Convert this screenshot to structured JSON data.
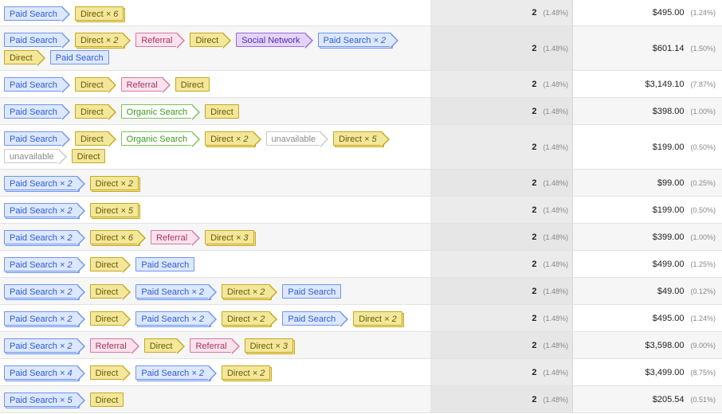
{
  "colors": {
    "paid_search": "#6f96ec",
    "direct": "#c6a81c",
    "referral": "#d67aa0",
    "social_network": "#9c6ad7",
    "organic_search": "#7cc25a",
    "unavailable": "#c9c9c9"
  },
  "rows": [
    {
      "h": 33,
      "path": [
        {
          "t": "paid",
          "label": "Paid Search",
          "mult": ""
        },
        {
          "t": "direct",
          "label": "Direct",
          "mult": "× 6"
        }
      ],
      "conversions": "2",
      "conv_pct": "(1.48%)",
      "value": "$495.00",
      "value_pct": "(1.24%)"
    },
    {
      "h": 56,
      "path": [
        {
          "t": "paid",
          "label": "Paid Search",
          "mult": ""
        },
        {
          "t": "direct",
          "label": "Direct",
          "mult": "× 2"
        },
        {
          "t": "ref",
          "label": "Referral",
          "mult": ""
        },
        {
          "t": "direct",
          "label": "Direct",
          "mult": ""
        },
        {
          "t": "social",
          "label": "Social Network",
          "mult": ""
        },
        {
          "t": "paid",
          "label": "Paid Search",
          "mult": "× 2"
        },
        {
          "t": "direct",
          "label": "Direct",
          "mult": ""
        },
        {
          "t": "paid",
          "label": "Paid Search",
          "mult": ""
        }
      ],
      "conversions": "2",
      "conv_pct": "(1.48%)",
      "value": "$601.14",
      "value_pct": "(1.50%)"
    },
    {
      "h": 34,
      "path": [
        {
          "t": "paid",
          "label": "Paid Search",
          "mult": ""
        },
        {
          "t": "direct",
          "label": "Direct",
          "mult": ""
        },
        {
          "t": "ref",
          "label": "Referral",
          "mult": ""
        },
        {
          "t": "direct",
          "label": "Direct",
          "mult": ""
        }
      ],
      "conversions": "2",
      "conv_pct": "(1.48%)",
      "value": "$3,149.10",
      "value_pct": "(7.87%)"
    },
    {
      "h": 34,
      "path": [
        {
          "t": "paid",
          "label": "Paid Search",
          "mult": ""
        },
        {
          "t": "direct",
          "label": "Direct",
          "mult": ""
        },
        {
          "t": "organic",
          "label": "Organic Search",
          "mult": ""
        },
        {
          "t": "direct",
          "label": "Direct",
          "mult": ""
        }
      ],
      "conversions": "2",
      "conv_pct": "(1.48%)",
      "value": "$398.00",
      "value_pct": "(1.00%)"
    },
    {
      "h": 56,
      "path": [
        {
          "t": "paid",
          "label": "Paid Search",
          "mult": ""
        },
        {
          "t": "direct",
          "label": "Direct",
          "mult": ""
        },
        {
          "t": "organic",
          "label": "Organic Search",
          "mult": ""
        },
        {
          "t": "direct",
          "label": "Direct",
          "mult": "× 2"
        },
        {
          "t": "unav",
          "label": "unavailable",
          "mult": ""
        },
        {
          "t": "direct",
          "label": "Direct",
          "mult": "× 5"
        },
        {
          "t": "unav",
          "label": "unavailable",
          "mult": ""
        },
        {
          "t": "direct",
          "label": "Direct",
          "mult": ""
        }
      ],
      "conversions": "2",
      "conv_pct": "(1.48%)",
      "value": "$199.00",
      "value_pct": "(0.50%)"
    },
    {
      "h": 34,
      "path": [
        {
          "t": "paid",
          "label": "Paid Search",
          "mult": "× 2"
        },
        {
          "t": "direct",
          "label": "Direct",
          "mult": "× 2"
        }
      ],
      "conversions": "2",
      "conv_pct": "(1.48%)",
      "value": "$99.00",
      "value_pct": "(0.25%)"
    },
    {
      "h": 34,
      "path": [
        {
          "t": "paid",
          "label": "Paid Search",
          "mult": "× 2"
        },
        {
          "t": "direct",
          "label": "Direct",
          "mult": "× 5"
        }
      ],
      "conversions": "2",
      "conv_pct": "(1.48%)",
      "value": "$199.00",
      "value_pct": "(0.50%)"
    },
    {
      "h": 34,
      "path": [
        {
          "t": "paid",
          "label": "Paid Search",
          "mult": "× 2"
        },
        {
          "t": "direct",
          "label": "Direct",
          "mult": "× 6"
        },
        {
          "t": "ref",
          "label": "Referral",
          "mult": ""
        },
        {
          "t": "direct",
          "label": "Direct",
          "mult": "× 3"
        }
      ],
      "conversions": "2",
      "conv_pct": "(1.48%)",
      "value": "$399.00",
      "value_pct": "(1.00%)"
    },
    {
      "h": 34,
      "path": [
        {
          "t": "paid",
          "label": "Paid Search",
          "mult": "× 2"
        },
        {
          "t": "direct",
          "label": "Direct",
          "mult": ""
        },
        {
          "t": "paid",
          "label": "Paid Search",
          "mult": ""
        }
      ],
      "conversions": "2",
      "conv_pct": "(1.48%)",
      "value": "$499.00",
      "value_pct": "(1.25%)"
    },
    {
      "h": 34,
      "path": [
        {
          "t": "paid",
          "label": "Paid Search",
          "mult": "× 2"
        },
        {
          "t": "direct",
          "label": "Direct",
          "mult": ""
        },
        {
          "t": "paid",
          "label": "Paid Search",
          "mult": "× 2"
        },
        {
          "t": "direct",
          "label": "Direct",
          "mult": "× 2"
        },
        {
          "t": "paid",
          "label": "Paid Search",
          "mult": ""
        }
      ],
      "conversions": "2",
      "conv_pct": "(1.48%)",
      "value": "$49.00",
      "value_pct": "(0.12%)"
    },
    {
      "h": 34,
      "path": [
        {
          "t": "paid",
          "label": "Paid Search",
          "mult": "× 2"
        },
        {
          "t": "direct",
          "label": "Direct",
          "mult": ""
        },
        {
          "t": "paid",
          "label": "Paid Search",
          "mult": "× 2"
        },
        {
          "t": "direct",
          "label": "Direct",
          "mult": "× 2"
        },
        {
          "t": "paid",
          "label": "Paid Search",
          "mult": ""
        },
        {
          "t": "direct",
          "label": "Direct",
          "mult": "× 2"
        }
      ],
      "conversions": "2",
      "conv_pct": "(1.48%)",
      "value": "$495.00",
      "value_pct": "(1.24%)"
    },
    {
      "h": 34,
      "path": [
        {
          "t": "paid",
          "label": "Paid Search",
          "mult": "× 2"
        },
        {
          "t": "ref",
          "label": "Referral",
          "mult": ""
        },
        {
          "t": "direct",
          "label": "Direct",
          "mult": ""
        },
        {
          "t": "ref",
          "label": "Referral",
          "mult": ""
        },
        {
          "t": "direct",
          "label": "Direct",
          "mult": "× 3"
        }
      ],
      "conversions": "2",
      "conv_pct": "(1.48%)",
      "value": "$3,598.00",
      "value_pct": "(9.00%)"
    },
    {
      "h": 34,
      "path": [
        {
          "t": "paid",
          "label": "Paid Search",
          "mult": "× 4"
        },
        {
          "t": "direct",
          "label": "Direct",
          "mult": ""
        },
        {
          "t": "paid",
          "label": "Paid Search",
          "mult": "× 2"
        },
        {
          "t": "direct",
          "label": "Direct",
          "mult": "× 2"
        }
      ],
      "conversions": "2",
      "conv_pct": "(1.48%)",
      "value": "$3,499.00",
      "value_pct": "(8.75%)"
    },
    {
      "h": 34,
      "path": [
        {
          "t": "paid",
          "label": "Paid Search",
          "mult": "× 5"
        },
        {
          "t": "direct",
          "label": "Direct",
          "mult": ""
        }
      ],
      "conversions": "2",
      "conv_pct": "(1.48%)",
      "value": "$205.54",
      "value_pct": "(0.51%)"
    }
  ]
}
